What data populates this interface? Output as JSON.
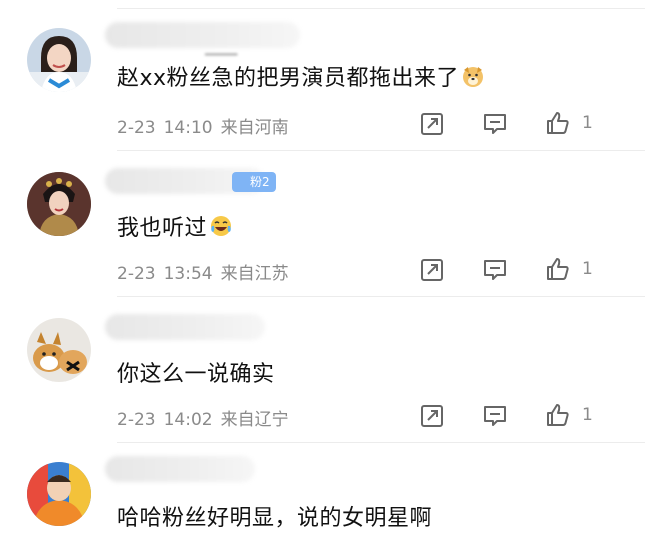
{
  "comments": [
    {
      "text": "赵xx粉丝急的把男演员都拖出来了",
      "emoji": "dog-face-emoji",
      "date": "2-23",
      "time": "14:10",
      "location": "来自河南",
      "likes": "1",
      "fan_badge": null
    },
    {
      "text": "我也听过",
      "emoji": "laughing-crying-emoji",
      "date": "2-23",
      "time": "13:54",
      "location": "来自江苏",
      "likes": "1",
      "fan_badge": "粉2"
    },
    {
      "text": "你这么一说确实",
      "emoji": null,
      "date": "2-23",
      "time": "14:02",
      "location": "来自辽宁",
      "likes": "1",
      "fan_badge": null
    },
    {
      "text": "哈哈粉丝好明显，说的女明星啊",
      "emoji": null,
      "date": null,
      "time": null,
      "location": null,
      "likes": null,
      "fan_badge": null
    }
  ],
  "icons": {
    "share": "share-icon",
    "comment": "comment-icon",
    "like": "thumbs-up-icon"
  },
  "colors": {
    "meta_text": "#8a8a8a",
    "fan_badge": "#7fb4f5"
  }
}
